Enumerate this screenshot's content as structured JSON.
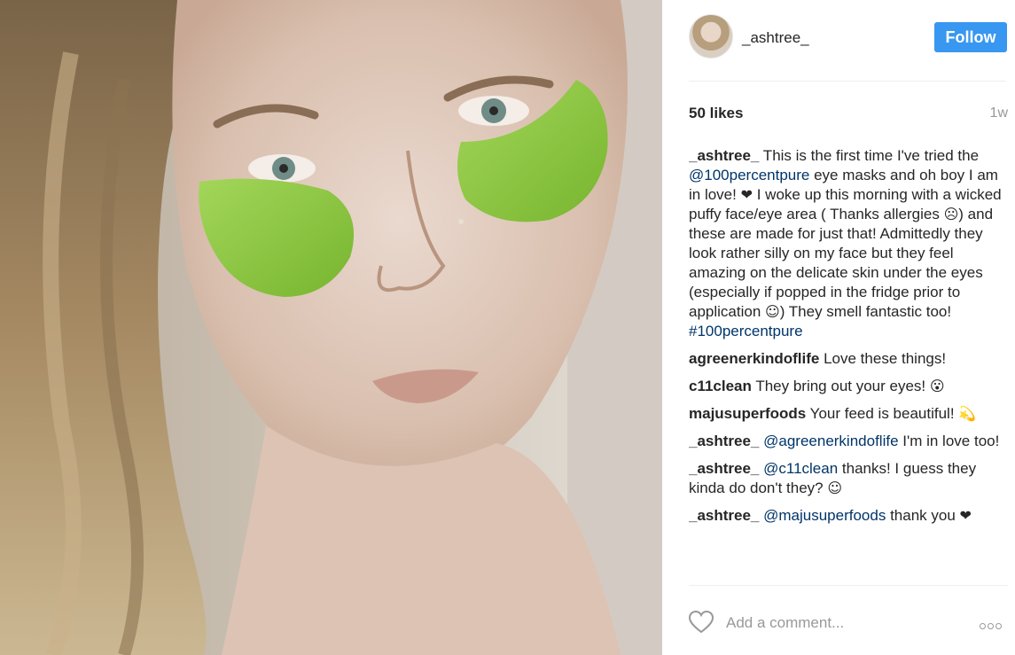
{
  "post": {
    "username": "_ashtree_",
    "follow_label": "Follow",
    "likes": "50 likes",
    "age": "1w"
  },
  "comments": [
    {
      "user": "_ashtree_",
      "parts": [
        {
          "t": " This is the first time I've tried the "
        },
        {
          "m": "@100percentpure"
        },
        {
          "t": " eye masks and oh boy I am in love! "
        },
        {
          "e": "❤"
        },
        {
          "t": " I woke up this morning with a wicked puffy face/eye area ( Thanks allergies "
        },
        {
          "e": "☹"
        },
        {
          "t": ") and these are made for just that! Admittedly they look rather silly on my face but they feel amazing on the delicate skin under the eyes (especially if popped in the fridge prior to application "
        },
        {
          "e": "☺"
        },
        {
          "t": ") They smell fantastic too! "
        },
        {
          "h": "#100percentpure"
        }
      ]
    },
    {
      "user": "agreenerkindoflife",
      "parts": [
        {
          "t": " Love these things!"
        }
      ]
    },
    {
      "user": "c11clean",
      "parts": [
        {
          "t": " They bring out your eyes! "
        },
        {
          "e": "😮"
        }
      ]
    },
    {
      "user": "majusuperfoods",
      "parts": [
        {
          "t": " Your feed is beautiful! "
        },
        {
          "e": "💫"
        }
      ]
    },
    {
      "user": "_ashtree_",
      "parts": [
        {
          "t": " "
        },
        {
          "m": "@agreenerkindoflife"
        },
        {
          "t": " I'm in love too!"
        }
      ]
    },
    {
      "user": "_ashtree_",
      "parts": [
        {
          "t": " "
        },
        {
          "m": "@c11clean"
        },
        {
          "t": " thanks! I guess they kinda do don't they? "
        },
        {
          "e": "☺"
        }
      ]
    },
    {
      "user": "_ashtree_",
      "parts": [
        {
          "t": " "
        },
        {
          "m": "@majusuperfoods"
        },
        {
          "t": " thank you "
        },
        {
          "e": "❤"
        }
      ]
    }
  ],
  "footer": {
    "comment_placeholder": "Add a comment...",
    "like_icon": "heart-outline-icon",
    "more_icon": "more-options-icon"
  },
  "colors": {
    "follow_button": "#3897f0",
    "link": "#003569",
    "muted": "#999999",
    "eye_mask_green": "#8cc63f"
  }
}
